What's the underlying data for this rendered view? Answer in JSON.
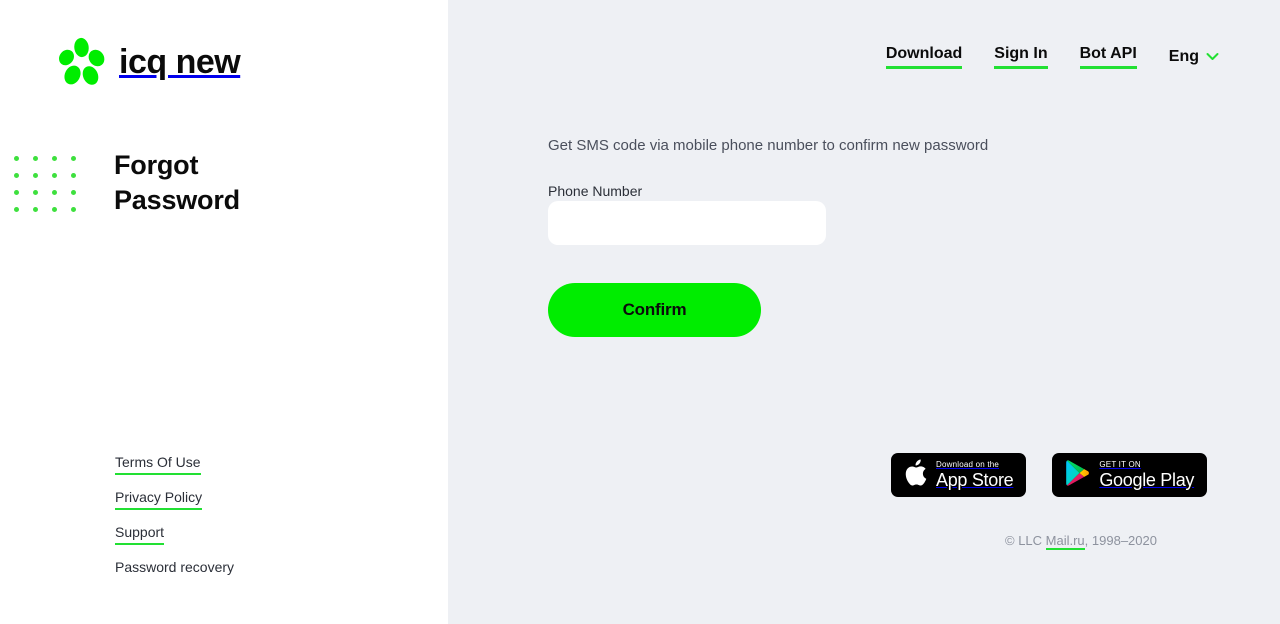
{
  "brand": {
    "logo_text": "icq new",
    "logo_icon": "icq-flower-icon",
    "green": "#00ed00",
    "accent_underline": "#22e033"
  },
  "header": {
    "nav": [
      {
        "label": "Download",
        "name": "nav-link-download"
      },
      {
        "label": "Sign In",
        "name": "nav-link-sign-in"
      },
      {
        "label": "Bot API",
        "name": "nav-link-bot-api"
      }
    ],
    "language": {
      "label": "Eng",
      "icon": "chevron-down-icon"
    }
  },
  "sidebar": {
    "title_line1": "Forgot",
    "title_line2": "Password",
    "decoration": "dot-grid",
    "dot_columns": 5,
    "dot_rows": 4,
    "links": [
      {
        "label": "Terms Of Use",
        "name": "footer-link-terms-of-use",
        "underlined": true
      },
      {
        "label": "Privacy Policy",
        "name": "footer-link-privacy-policy",
        "underlined": true
      },
      {
        "label": "Support",
        "name": "footer-link-support",
        "underlined": true
      },
      {
        "label": "Password recovery",
        "name": "footer-link-password-recovery",
        "underlined": false
      }
    ]
  },
  "main": {
    "description": "Get SMS code via mobile phone number to confirm new password",
    "phone_field": {
      "label": "Phone Number",
      "value": "",
      "placeholder": ""
    },
    "confirm_label": "Confirm"
  },
  "footer": {
    "badges": [
      {
        "name": "app-store-badge",
        "icon": "apple-icon",
        "small": "Download on the",
        "big": "App Store"
      },
      {
        "name": "google-play-badge",
        "icon": "google-play-icon",
        "small": "GET IT ON",
        "big": "Google Play"
      }
    ],
    "copyright_prefix": "© LLC ",
    "copyright_link": "Mail.ru",
    "copyright_suffix": ", 1998–2020"
  }
}
